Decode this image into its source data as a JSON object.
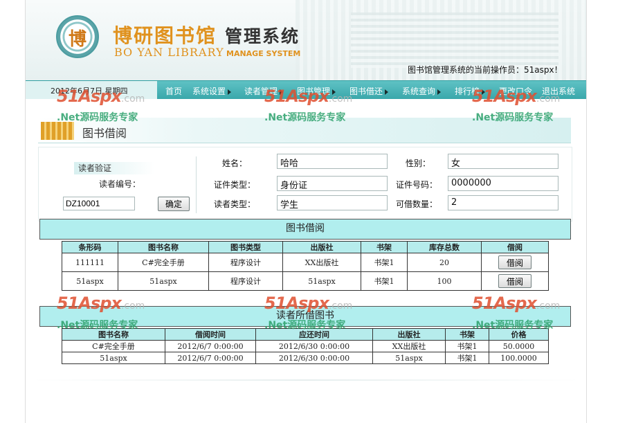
{
  "header": {
    "logo_seal_char": "博",
    "title_brand": "博研图书馆",
    "title_system": "管理系统",
    "subtitle_en": "BO YAN LIBRARY",
    "subtitle_en2": "MANAGE SYSTEM",
    "operator_text": "图书馆管理系统的当前操作员：51aspx！"
  },
  "nav": {
    "date": "2012年6月7日  星期四",
    "items": [
      {
        "label": "首页",
        "has_arrow": false
      },
      {
        "label": "系统设置",
        "has_arrow": true
      },
      {
        "label": "读者管理",
        "has_arrow": true
      },
      {
        "label": "图书管理",
        "has_arrow": true
      },
      {
        "label": "图书借还",
        "has_arrow": true
      },
      {
        "label": "系统查询",
        "has_arrow": true
      },
      {
        "label": "排行榜",
        "has_arrow": true
      },
      {
        "label": "更改口令",
        "has_arrow": false
      },
      {
        "label": "退出系统",
        "has_arrow": false
      }
    ]
  },
  "section": {
    "title": "图书借阅"
  },
  "reader": {
    "verify_title": "读者验证",
    "id_label": "读者编号：",
    "id_value": "DZ10001",
    "confirm_label": "确定",
    "name_label": "姓名：",
    "name_value": "哈哈",
    "gender_label": "性别：",
    "gender_value": "女",
    "cert_type_label": "证件类型：",
    "cert_type_value": "身份证",
    "cert_no_label": "证件号码：",
    "cert_no_value": "0000000",
    "reader_type_label": "读者类型：",
    "reader_type_value": "学生",
    "borrow_count_label": "可借数量：",
    "borrow_count_value": "2"
  },
  "borrow": {
    "bar_title": "图书借阅",
    "columns": [
      "条形码",
      "图书名称",
      "图书类型",
      "出版社",
      "书架",
      "库存总数",
      "借阅"
    ],
    "rows": [
      {
        "barcode": "111111",
        "name": "C#完全手册",
        "type": "程序设计",
        "publisher": "XX出版社",
        "shelf": "书架1",
        "stock": "20",
        "action": "借阅"
      },
      {
        "barcode": "51aspx",
        "name": "51aspx",
        "type": "程序设计",
        "publisher": "51aspx",
        "shelf": "书架1",
        "stock": "100",
        "action": "借阅"
      }
    ]
  },
  "lent": {
    "bar_title": "读者所借图书",
    "columns": [
      "图书名称",
      "借阅时间",
      "应还时间",
      "出版社",
      "书架",
      "价格"
    ],
    "rows": [
      {
        "name": "C#完全手册",
        "borrow_time": "2012/6/7 0:00:00",
        "due_time": "2012/6/30 0:00:00",
        "publisher": "XX出版社",
        "shelf": "书架1",
        "price": "50.0000"
      },
      {
        "name": "51aspx",
        "borrow_time": "2012/6/7 0:00:00",
        "due_time": "2012/6/30 0:00:00",
        "publisher": "51aspx",
        "shelf": "书架1",
        "price": "100.0000"
      }
    ]
  },
  "watermark": {
    "brand": "51Aspx",
    "domain": ".com",
    "slogan": ".Net源码服务专家"
  }
}
